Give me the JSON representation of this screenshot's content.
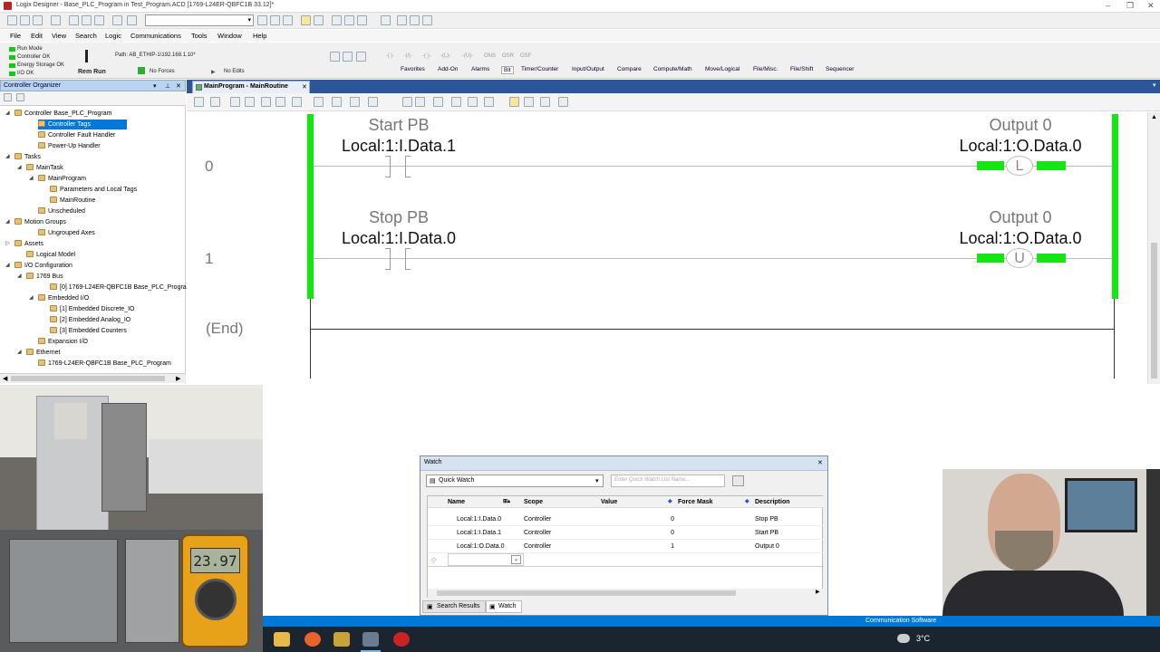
{
  "window": {
    "title": "Logix Designer - Base_PLC_Program in Test_Program.ACD [1769-L24ER-QBFC1B 33.12]*"
  },
  "menu": [
    "File",
    "Edit",
    "View",
    "Search",
    "Logic",
    "Communications",
    "Tools",
    "Window",
    "Help"
  ],
  "status": {
    "run_mode": "Run Mode",
    "controller_ok": "Controller OK",
    "energy_ok": "Energy Storage OK",
    "io_ok": "I/O OK",
    "mode": "Rem Run",
    "forces": "No Forces",
    "edits": "No Edits",
    "path": "Path: AB_ETHIP-1\\192.168.1.10*"
  },
  "instruction_tabs": [
    "Favorites",
    "Add-On",
    "Alarms",
    "Bit",
    "Timer/Counter",
    "Input/Output",
    "Compare",
    "Compute/Math",
    "Move/Logical",
    "File/Misc.",
    "File/Shift",
    "Sequencer"
  ],
  "instruction_icons": [
    "-| |-",
    "-|/|-",
    "-( )-",
    "-(L)-",
    "-(U)-",
    "ONS",
    "OSR",
    "OSF"
  ],
  "organizer": {
    "title": "Controller Organizer",
    "items": [
      {
        "label": "Controller Base_PLC_Program",
        "depth": 0,
        "exp": "◢"
      },
      {
        "label": "Controller Tags",
        "depth": 2,
        "selected": true
      },
      {
        "label": "Controller Fault Handler",
        "depth": 2
      },
      {
        "label": "Power-Up Handler",
        "depth": 2
      },
      {
        "label": "Tasks",
        "depth": 0,
        "exp": "◢"
      },
      {
        "label": "MainTask",
        "depth": 1,
        "exp": "◢"
      },
      {
        "label": "MainProgram",
        "depth": 2,
        "exp": "◢"
      },
      {
        "label": "Parameters and Local Tags",
        "depth": 3
      },
      {
        "label": "MainRoutine",
        "depth": 3
      },
      {
        "label": "Unscheduled",
        "depth": 2
      },
      {
        "label": "Motion Groups",
        "depth": 0,
        "exp": "◢"
      },
      {
        "label": "Ungrouped Axes",
        "depth": 2
      },
      {
        "label": "Assets",
        "depth": 0,
        "exp": "▷"
      },
      {
        "label": "Logical Model",
        "depth": 1
      },
      {
        "label": "I/O Configuration",
        "depth": 0,
        "exp": "◢"
      },
      {
        "label": "1769 Bus",
        "depth": 1,
        "exp": "◢"
      },
      {
        "label": "[0] 1769-L24ER-QBFC1B Base_PLC_Program",
        "depth": 3
      },
      {
        "label": "Embedded I/O",
        "depth": 2,
        "exp": "◢"
      },
      {
        "label": "[1] Embedded Discrete_IO",
        "depth": 3
      },
      {
        "label": "[2] Embedded Analog_IO",
        "depth": 3
      },
      {
        "label": "[3] Embedded Counters",
        "depth": 3
      },
      {
        "label": "Expansion I/O",
        "depth": 2
      },
      {
        "label": "Ethernet",
        "depth": 1,
        "exp": "◢"
      },
      {
        "label": "1769-L24ER-QBFC1B Base_PLC_Program",
        "depth": 2
      }
    ]
  },
  "editor": {
    "tab": "MainProgram - MainRoutine"
  },
  "ladder": {
    "rungs": [
      {
        "number": "0",
        "contact_label": "Start PB",
        "contact_addr": "Local:1:I.Data.1",
        "coil_label": "Output 0",
        "coil_addr": "Local:1:O.Data.0",
        "coil_type": "L"
      },
      {
        "number": "1",
        "contact_label": "Stop PB",
        "contact_addr": "Local:1:I.Data.0",
        "coil_label": "Output 0",
        "coil_addr": "Local:1:O.Data.0",
        "coil_type": "U"
      }
    ],
    "end": "(End)"
  },
  "watch": {
    "title": "Watch",
    "selector": "Quick Watch",
    "list_placeholder": "Enter Quick Watch List Name...",
    "columns": [
      "Name",
      "Scope",
      "Value",
      "Force Mask",
      "Description"
    ],
    "rows": [
      {
        "name": "Local:1:I.Data.0",
        "scope": "Controller",
        "value": "0",
        "desc": "Stop PB"
      },
      {
        "name": "Local:1:I.Data.1",
        "scope": "Controller",
        "value": "0",
        "desc": "Start PB"
      },
      {
        "name": "Local:1:O.Data.0",
        "scope": "Controller",
        "value": "1",
        "desc": "Output 0"
      }
    ],
    "tabs": [
      "Search Results",
      "Watch"
    ]
  },
  "statusbar": {
    "text": "Communication Software"
  },
  "taskbar": {
    "weather": "3°C"
  },
  "meter": {
    "reading": "23.97"
  }
}
